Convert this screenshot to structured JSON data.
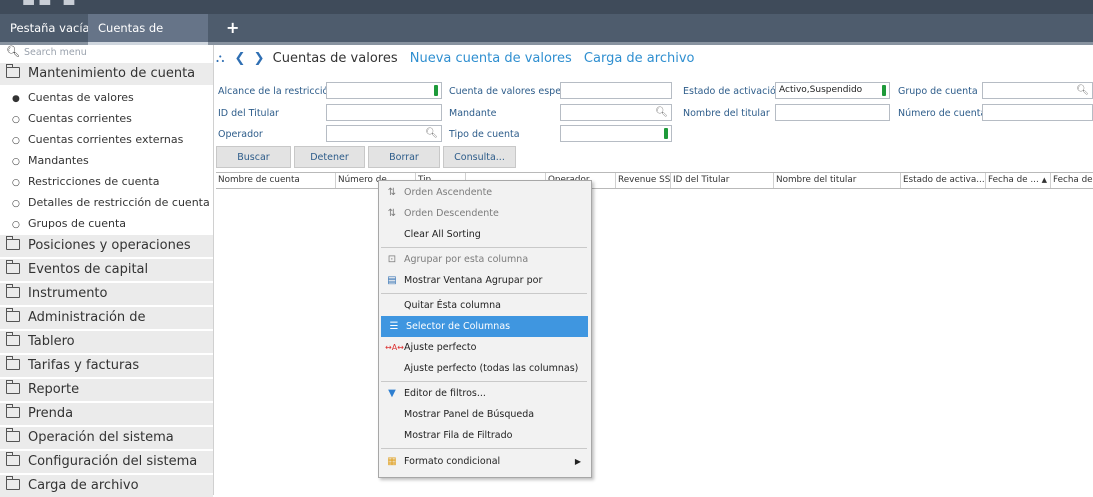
{
  "tabs": {
    "tab1": "Pestaña vacía",
    "tab2": "Cuentas de valores",
    "add": "+"
  },
  "sidebar": {
    "search_placeholder": "Search menu",
    "groups": [
      "Mantenimiento de cuenta",
      "Posiciones y operaciones",
      "Eventos de capital",
      "Instrumento",
      "Administración de participantes",
      "Tablero",
      "Tarifas y facturas",
      "Reporte",
      "Prenda",
      "Operación del sistema",
      "Configuración del sistema",
      "Carga de archivo"
    ],
    "sub_items": [
      "Cuentas de valores",
      "Cuentas corrientes",
      "Cuentas corrientes externas",
      "Mandantes",
      "Restricciones de cuenta",
      "Detalles de restricción de cuenta",
      "Grupos de cuenta"
    ]
  },
  "breadcrumb": {
    "title": "Cuentas de valores",
    "link1": "Nueva cuenta de valores",
    "link2": "Carga de archivo"
  },
  "filters": {
    "alcance_label": "Alcance de la restricción",
    "espejo_label": "Cuenta de valores espejo",
    "estado_label": "Estado de activación",
    "estado_value": "Activo,Suspendido",
    "grupo_label": "Grupo de cuenta",
    "titular_id_label": "ID del Titular",
    "mandante_label": "Mandante",
    "nombre_titular_label": "Nombre del titular",
    "numero_label": "Número de cuenta",
    "operador_label": "Operador",
    "tipo_label": "Tipo de cuenta"
  },
  "buttons": {
    "buscar": "Buscar",
    "detener": "Detener",
    "borrar": "Borrar",
    "consulta": "Consulta..."
  },
  "grid": {
    "columns": [
      "Nombre de cuenta",
      "Número de",
      "Tip",
      "",
      "Operador",
      "Revenue SSI",
      "ID del Titular",
      "Nombre del titular",
      "Estado de activa...",
      "Fecha de ...",
      "Fecha de"
    ]
  },
  "context_menu": {
    "items": [
      "Orden Ascendente",
      "Orden Descendente",
      "Clear All Sorting",
      "Agrupar por esta columna",
      "Mostrar Ventana Agrupar por",
      "Quitar Ésta columna",
      "Selector de Columnas",
      "Ajuste perfecto",
      "Ajuste perfecto (todas las columnas)",
      "Editor de filtros...",
      "Mostrar Panel de Búsqueda",
      "Mostrar Fila de Filtrado",
      "Formato condicional"
    ],
    "selected_index": 6
  },
  "colors": {
    "tabbar": "#4e5c6d",
    "accent_link": "#2f8fd0",
    "menu_selected": "#3f96e0"
  }
}
